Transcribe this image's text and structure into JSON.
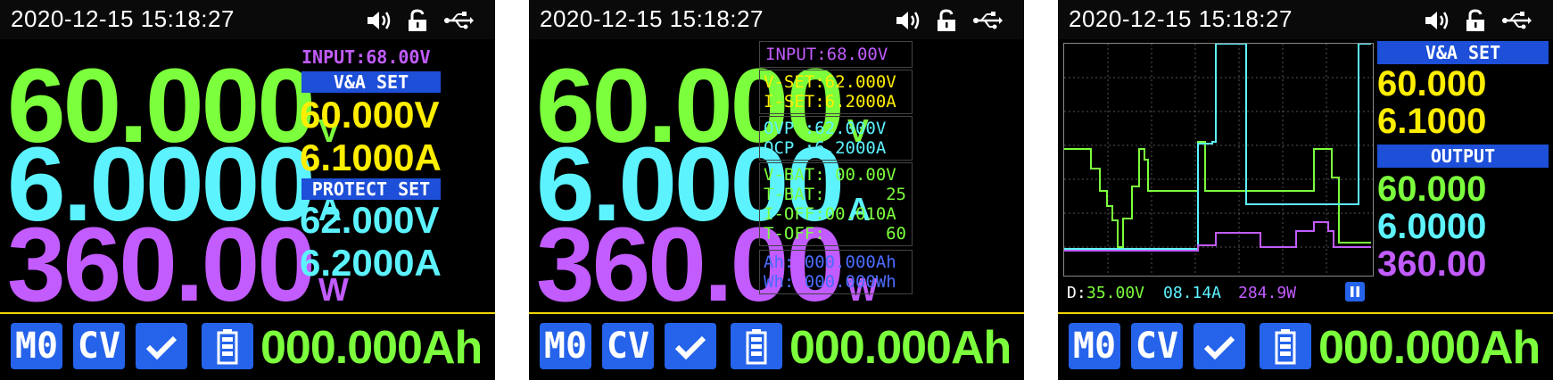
{
  "datetime": "2020-12-15 15:18:27",
  "icons": {
    "speaker": "speaker-icon",
    "lock": "lock-open-icon",
    "usb": "usb-icon",
    "check": "check-icon",
    "battery": "battery-icon",
    "pause": "pause-icon"
  },
  "colors": {
    "voltage": "#7cff3c",
    "current": "#5cf3ff",
    "power": "#c25cff",
    "set": "#ffee00",
    "banner": "#1d4fd8",
    "button": "#2563eb",
    "separator": "#f2d600",
    "input": "#c25cff"
  },
  "readout": {
    "voltage": "60.000",
    "voltage_unit": "V",
    "current": "6.0000",
    "current_unit": "A",
    "power": "360.00",
    "power_unit": "W"
  },
  "bottom": {
    "m0": "M0",
    "cv": "CV",
    "ah": "000.000Ah"
  },
  "screen1": {
    "input": "INPUT:68.00V",
    "va_set_label": "V&A SET",
    "set_voltage": "60.000V",
    "set_current": "6.1000A",
    "protect_set_label": "PROTECT SET",
    "protect_voltage": "62.000V",
    "protect_current": "6.2000A"
  },
  "screen2": {
    "input": "INPUT:68.00V",
    "v_set": "V-SET:62.000V",
    "i_set": "I-SET:6.2000A",
    "ovp": "OVP :62.000V",
    "ocp": "OCP :6.2000A",
    "v_bat": "V-BAT: 00.00V",
    "t_bat_label": "T-BAT:",
    "t_bat_value": "25",
    "i_off": "I-OFF:00.010A",
    "t_off_label": "T-OFF:",
    "t_off_value": "60",
    "ah": "Ah: 000.000Ah",
    "wh": "Wh: 000.000Wh"
  },
  "screen3": {
    "va_set_label": "V&A SET",
    "set_voltage": "60.000",
    "set_current": "6.1000",
    "output_label": "OUTPUT",
    "out_voltage": "60.000",
    "out_current": "6.0000",
    "out_power": "360.00",
    "foot_d": "D:",
    "foot_v": "35.00V",
    "foot_a": "08.14A",
    "foot_w": "284.9W"
  }
}
